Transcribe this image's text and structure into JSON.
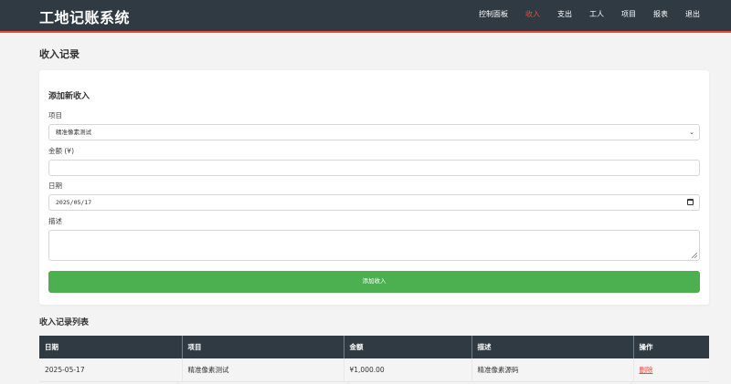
{
  "header": {
    "brand": "工地记账系统",
    "nav": [
      "控制面板",
      "收入",
      "支出",
      "工人",
      "项目",
      "报表",
      "退出"
    ],
    "active_index": 1
  },
  "page": {
    "title": "收入记录"
  },
  "form": {
    "title": "添加新收入",
    "project_label": "项目",
    "project_value": "精准像素测试",
    "amount_label": "金额 (¥)",
    "amount_value": "",
    "date_label": "日期",
    "date_value": "2025/05/17",
    "desc_label": "描述",
    "desc_value": "",
    "submit_label": "添加收入"
  },
  "list": {
    "title": "收入记录列表",
    "columns": [
      "日期",
      "项目",
      "金额",
      "描述",
      "操作"
    ],
    "rows": [
      {
        "date": "2025-05-17",
        "project": "精准像素测试",
        "amount": "¥1,000.00",
        "desc": "精准像素源码",
        "action": "删除"
      }
    ]
  },
  "colors": {
    "header_bg": "#2f3a42",
    "accent": "#e74c3c",
    "submit_bg": "#4caf50"
  }
}
